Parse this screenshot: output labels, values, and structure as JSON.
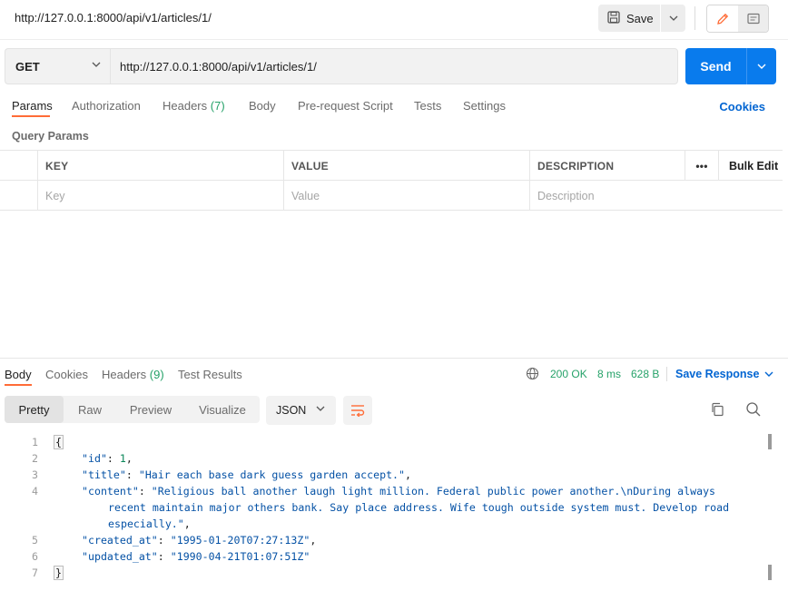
{
  "header": {
    "title": "http://127.0.0.1:8000/api/v1/articles/1/",
    "save_label": "Save",
    "icons": {
      "save": "save-icon",
      "edit": "pencil-icon",
      "comment": "comment-icon"
    },
    "accent_color": "#ff6c37"
  },
  "request": {
    "method": "GET",
    "url": "http://127.0.0.1:8000/api/v1/articles/1/",
    "send_label": "Send",
    "send_color": "#097bed",
    "tabs": [
      {
        "label": "Params",
        "count": "",
        "active": true
      },
      {
        "label": "Authorization",
        "count": "",
        "active": false
      },
      {
        "label": "Headers",
        "count": "(7)",
        "active": false
      },
      {
        "label": "Body",
        "count": "",
        "active": false
      },
      {
        "label": "Pre-request Script",
        "count": "",
        "active": false
      },
      {
        "label": "Tests",
        "count": "",
        "active": false
      },
      {
        "label": "Settings",
        "count": "",
        "active": false
      }
    ],
    "cookies_label": "Cookies",
    "query_params_title": "Query Params",
    "table": {
      "headers": {
        "key": "KEY",
        "value": "VALUE",
        "description": "DESCRIPTION",
        "more": "•••",
        "bulk_edit": "Bulk Edit"
      },
      "placeholders": {
        "key": "Key",
        "value": "Value",
        "description": "Description"
      }
    }
  },
  "response": {
    "tabs": [
      {
        "label": "Body",
        "count": "",
        "active": true
      },
      {
        "label": "Cookies",
        "count": "",
        "active": false
      },
      {
        "label": "Headers",
        "count": "(9)",
        "active": false
      },
      {
        "label": "Test Results",
        "count": "",
        "active": false
      }
    ],
    "status": "200 OK",
    "time": "8 ms",
    "size": "628 B",
    "status_color": "#26a269",
    "save_response_label": "Save Response",
    "views": [
      {
        "label": "Pretty",
        "active": true
      },
      {
        "label": "Raw",
        "active": false
      },
      {
        "label": "Preview",
        "active": false
      },
      {
        "label": "Visualize",
        "active": false
      }
    ],
    "format": "JSON",
    "body": {
      "id": "1",
      "title": "Hair each base dark guess garden accept.",
      "content_line1": "Religious ball another laugh light million. Federal public power another.\\nDuring always",
      "content_line2": "recent maintain major others bank. Say place address. Wife tough outside system must. Develop road",
      "content_line3": "especially.",
      "created_at": "1995-01-20T07:27:13Z",
      "updated_at": "1990-04-21T01:07:51Z"
    },
    "line_numbers": [
      "1",
      "2",
      "3",
      "4",
      "5",
      "6",
      "7"
    ]
  }
}
